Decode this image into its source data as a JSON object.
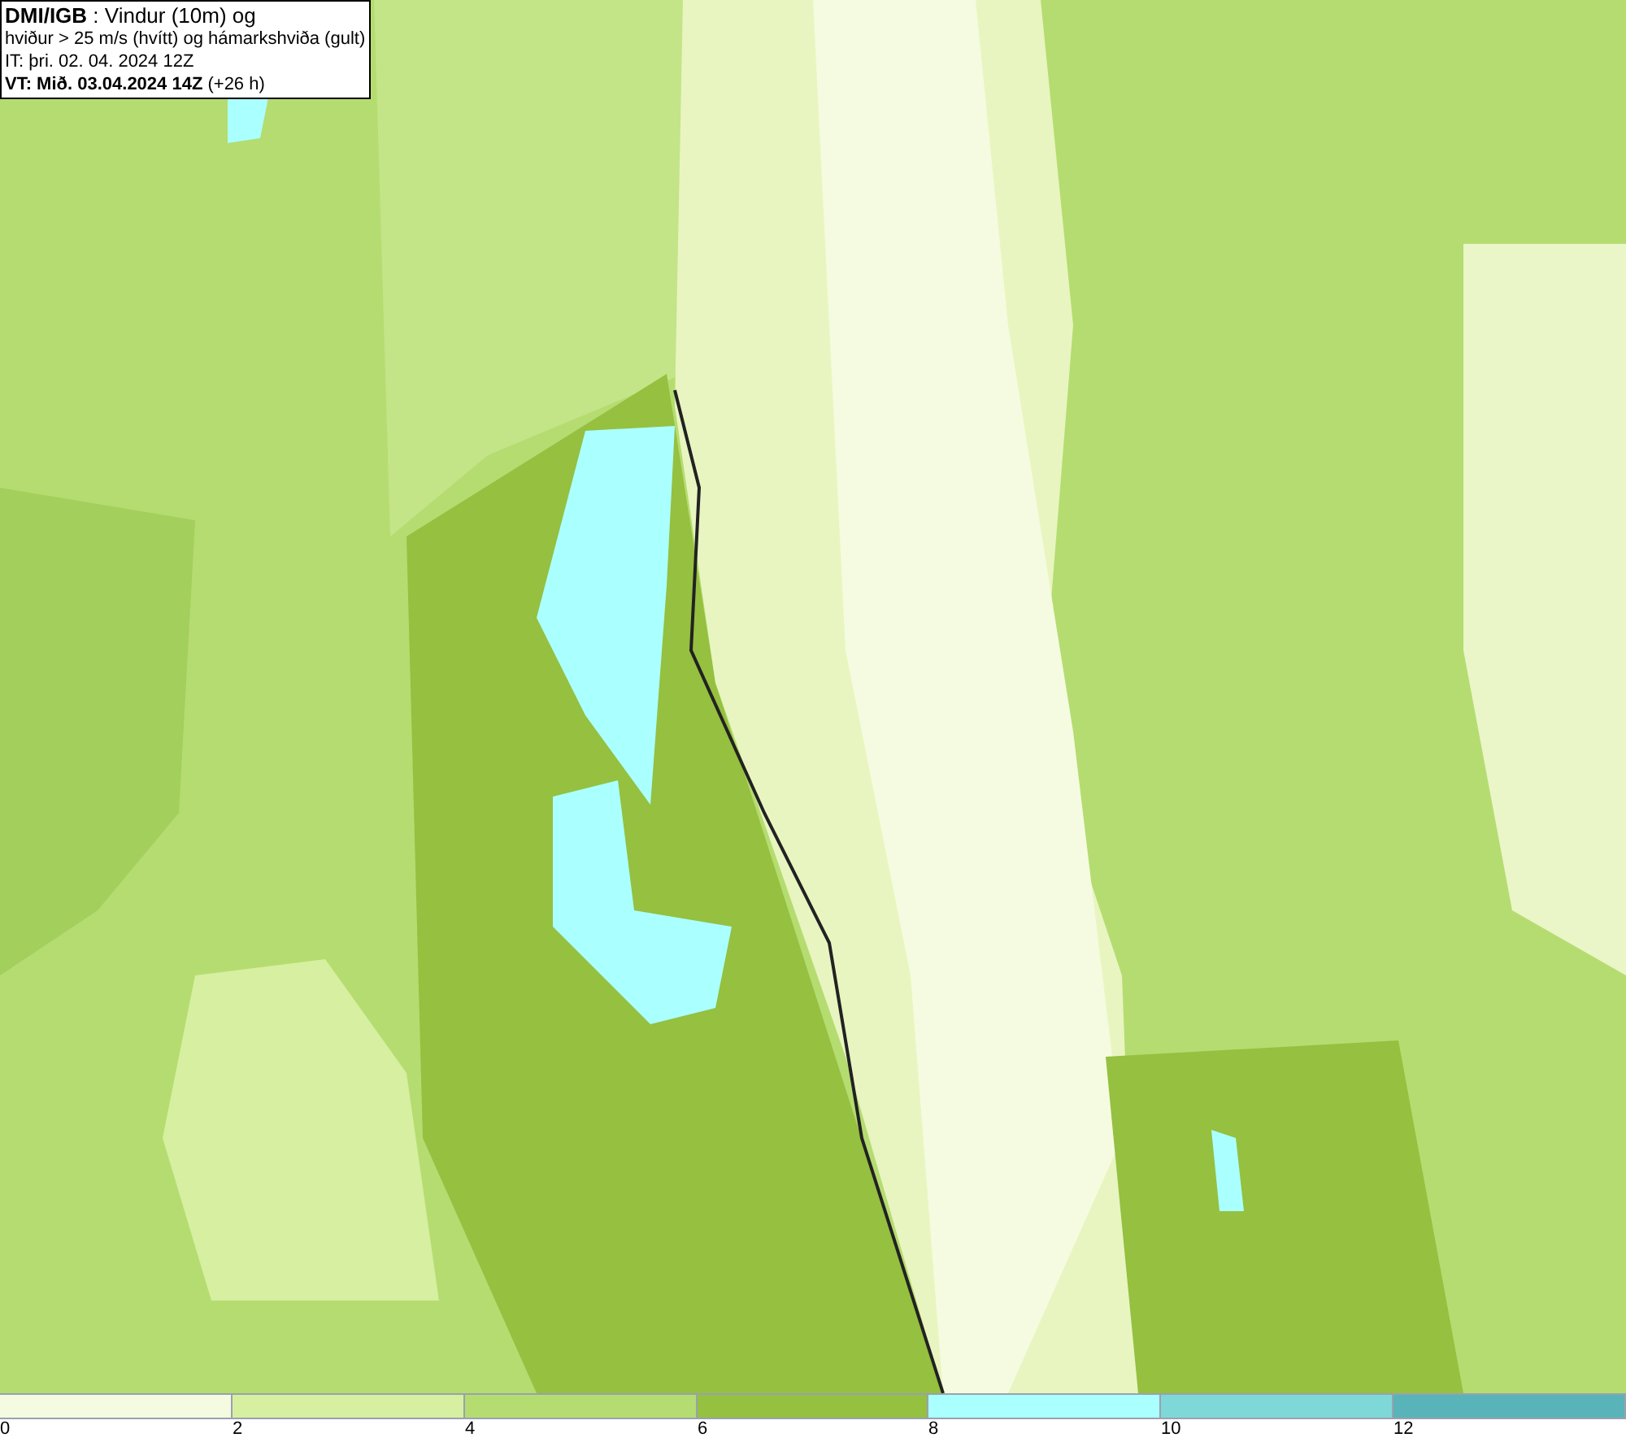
{
  "info_box": {
    "lines": [
      "**DMI/IGB** : Vindur (10m) og",
      "hviður > 25 m/s (hvítt) og hámarkshviða (gult)",
      "IT: þri. 02. 04. 2024 12Z",
      "**VT: Mið. 03.04.2024 14Z** (+26 h)"
    ]
  },
  "legend": {
    "segments": [
      {
        "color": "#f5fbe0"
      },
      {
        "color": "#d6efa0"
      },
      {
        "color": "#b5dc70"
      },
      {
        "color": "#95c040"
      },
      {
        "color": "#aaffff"
      },
      {
        "color": "#7fd8d8"
      },
      {
        "color": "#58b4b8"
      }
    ],
    "ticks": [
      "0",
      "2",
      "4",
      "6",
      "8",
      "10",
      "12"
    ]
  }
}
